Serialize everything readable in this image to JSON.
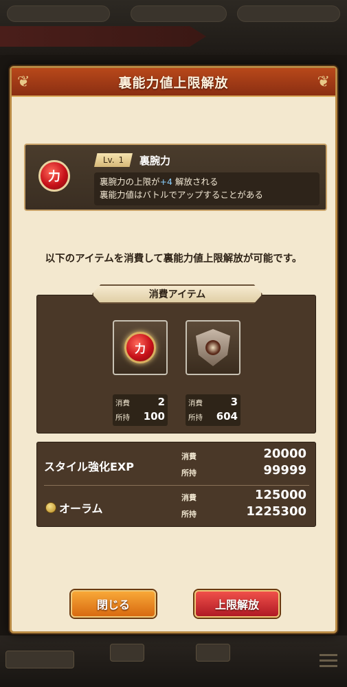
{
  "dialog": {
    "title": "裏能力値上限解放"
  },
  "ability": {
    "icon_char": "力",
    "level_label": "Lv.",
    "level_value": "1",
    "name": "裏腕力",
    "desc_line1_prefix": "裏腕力の上限が",
    "desc_line1_plus": "+4",
    "desc_line1_suffix": " 解放される",
    "desc_line2": "裏能力値はバトルでアップすることがある"
  },
  "instruction": "以下のアイテムを消費して裏能力値上限解放が可能です。",
  "consume": {
    "header": "消費アイテム",
    "items": [
      {
        "icon_char": "力",
        "icon": "strength-orb-icon",
        "consume_label": "消費",
        "consume": "2",
        "owned_label": "所持",
        "owned": "100"
      },
      {
        "icon": "shield-crest-icon",
        "consume_label": "消費",
        "consume": "3",
        "owned_label": "所持",
        "owned": "604"
      }
    ]
  },
  "resources": [
    {
      "name": "スタイル強化EXP",
      "consume_label": "消費",
      "consume": "20000",
      "owned_label": "所持",
      "owned": "99999"
    },
    {
      "name": "オーラム",
      "icon": "aurum-coin-icon",
      "consume_label": "消費",
      "consume": "125000",
      "owned_label": "所持",
      "owned": "1225300"
    }
  ],
  "buttons": {
    "close": "閉じる",
    "release": "上限解放"
  },
  "colors": {
    "header": "#a83c16",
    "panel": "#4a3828",
    "close_button": "#e88a20",
    "release_button": "#d0303a"
  }
}
